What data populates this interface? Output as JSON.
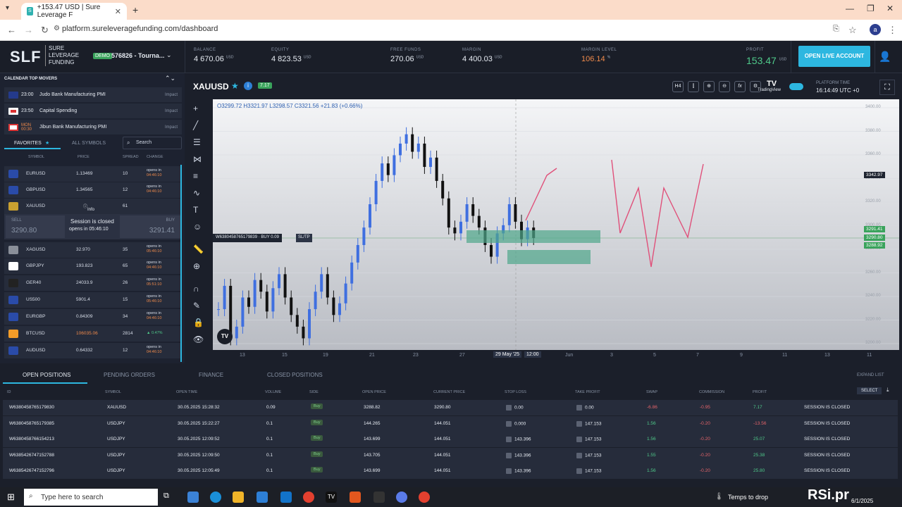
{
  "browser": {
    "tab_title": "+153.47 USD | Sure Leverage F",
    "url": "platform.sureleveragefunding.com/dashboard",
    "avatar": "a"
  },
  "header": {
    "logo": "SLF",
    "logo_sub": [
      "SURE",
      "LEVERAGE",
      "FUNDING"
    ],
    "demo": "DEMO",
    "account": "576826 - Tourna...",
    "balance_label": "BALANCE",
    "balance": "4 670.06",
    "currency": "USD",
    "equity_label": "EQUITY",
    "equity": "4 823.53",
    "free_funds_label": "FREE FUNDS",
    "free_funds": "270.06",
    "margin_label": "MARGIN",
    "margin": "4 400.03",
    "margin_level_label": "MARGIN LEVEL",
    "margin_level": "106.14",
    "margin_level_unit": "%",
    "profit_label": "PROFIT",
    "profit": "153.47",
    "open_live": "OPEN LIVE ACCOUNT"
  },
  "calendar": {
    "header": "CALENDAR  TOP MOVERS",
    "events": [
      {
        "time": "23:00",
        "name": "Judo Bank Manufacturing PMI",
        "impact": "Impact"
      },
      {
        "time": "23:50",
        "name": "Capital Spending",
        "impact": "Impact"
      },
      {
        "time": "MON 00:30",
        "name": "Jibun Bank Manufacturing PMI",
        "impact": "Impact"
      }
    ]
  },
  "symbols": {
    "tab_favorites": "FAVORITES",
    "tab_all": "ALL SYMBOLS",
    "search_placeholder": "Search",
    "col_symbol": "SYMBOL",
    "col_price": "PRICE",
    "col_spread": "SPREAD",
    "col_change": "CHANGE",
    "rows": [
      {
        "sym": "EURUSD",
        "price": "1.13469",
        "spread": "10",
        "open": "opens in",
        "t": "04:46:10"
      },
      {
        "sym": "GBPUSD",
        "price": "1.34565",
        "spread": "12",
        "open": "opens in",
        "t": "04:46:10"
      },
      {
        "sym": "XAUUSD",
        "price": "",
        "spread": "61",
        "open": "",
        "t": ""
      },
      {
        "sym": "XAGUSD",
        "price": "32.970",
        "spread": "35",
        "open": "opens in",
        "t": "05:46:10"
      },
      {
        "sym": "GBPJPY",
        "price": "193.823",
        "spread": "65",
        "open": "opens in",
        "t": "04:46:10"
      },
      {
        "sym": "GER40",
        "price": "24033.9",
        "spread": "26",
        "open": "opens in",
        "t": "05:51:10"
      },
      {
        "sym": "US500",
        "price": "5901.4",
        "spread": "15",
        "open": "opens in",
        "t": "05:46:10"
      },
      {
        "sym": "EURGBP",
        "price": "0.84309",
        "spread": "34",
        "open": "opens in",
        "t": "04:46:10"
      },
      {
        "sym": "BTCUSD",
        "price": "106035.06",
        "spread": "2814",
        "open": "▲ 0.47%",
        "t": ""
      },
      {
        "sym": "AUDUSD",
        "price": "0.64332",
        "spread": "12",
        "open": "opens in",
        "t": "04:46:10"
      }
    ],
    "xau_info": "Info",
    "sell_label": "SELL",
    "sell_price": "3290.80",
    "buy_label": "BUY",
    "buy_price": "3291.41",
    "session_closed": "Session is closed",
    "opens_in": "opens in 05:46:10"
  },
  "chart": {
    "symbol": "XAUUSD",
    "badge": "7.17",
    "timeframe": "H4",
    "ohlc": "O3299.72 H3321.97 L3298.57 C3321.56 +21.83 (+0.66%)",
    "tradingview": "TradingView",
    "platform_time_label": "PLATFORM TIME",
    "platform_time": "16:14:49 UTC +0",
    "position_label": "W638045876517983​9 · BUY 0.09",
    "sltp": "SL/TP",
    "price_labels": [
      "3342.97",
      "3291.41",
      "3290.80",
      "3288.92"
    ],
    "y_ticks": [
      "3400.00",
      "3380.00",
      "3360.00",
      "3340.00",
      "3320.00",
      "3300.00",
      "3280.00",
      "3260.00",
      "3240.00",
      "3220.00",
      "3200.00"
    ],
    "x_ticks": [
      "13",
      "15",
      "19",
      "21",
      "23",
      "27",
      "29 May '25",
      "12:00",
      "Jun",
      "3",
      "5",
      "7",
      "9",
      "11",
      "13",
      "11"
    ]
  },
  "chart_data": {
    "type": "candlestick",
    "title": "XAUUSD",
    "ylim": [
      3195,
      3410
    ],
    "closes": [
      3230,
      3250,
      3205,
      3215,
      3240,
      3232,
      3255,
      3245,
      3228,
      3248,
      3260,
      3240,
      3225,
      3215,
      3205,
      3230,
      3245,
      3260,
      3240,
      3225,
      3235,
      3252,
      3270,
      3285,
      3300,
      3320,
      3340,
      3355,
      3345,
      3362,
      3372,
      3380,
      3365,
      3372,
      3352,
      3360,
      3340,
      3325,
      3300,
      3295,
      3305,
      3320,
      3310,
      3300,
      3285,
      3275,
      3295,
      3302,
      3320,
      3305,
      3290,
      3300,
      3291
    ]
  },
  "bottom": {
    "tabs": [
      "OPEN POSITIONS",
      "PENDING ORDERS",
      "FINANCE",
      "CLOSED POSITIONS"
    ],
    "expand": "EXPAND LIST",
    "select": "SELECT",
    "headers": [
      "ID",
      "SYMBOL",
      "OPEN TIME",
      "VOLUME",
      "SIDE",
      "OPEN PRICE",
      "CURRENT PRICE",
      "STOP LOSS",
      "TAKE PROFIT",
      "SWAP",
      "COMMISSION",
      "PROFIT"
    ],
    "rows": [
      {
        "id": "W638045876517983​0",
        "sym": "XAUUSD",
        "time": "30.05.2025 15:28:32",
        "vol": "0.09",
        "side": "Buy",
        "open": "3288.82",
        "cur": "3290.80",
        "sl": "0.00",
        "tp": "0.00",
        "swap": "-6.86",
        "comm": "-0.95",
        "profit": "7.17",
        "status": "SESSION IS CLOSED"
      },
      {
        "id": "W638045876517938​5",
        "sym": "USDJPY",
        "time": "30.05.2025 15:22:27",
        "vol": "0.1",
        "side": "Buy",
        "open": "144.265",
        "cur": "144.051",
        "sl": "0.000",
        "tp": "147.153",
        "swap": "1.56",
        "comm": "-0.20",
        "profit": "-13.56",
        "status": "SESSION IS CLOSED"
      },
      {
        "id": "W638045876615421​3",
        "sym": "USDJPY",
        "time": "30.05.2025 12:09:52",
        "vol": "0.1",
        "side": "Buy",
        "open": "143.699",
        "cur": "144.051",
        "sl": "143.396",
        "tp": "147.153",
        "swap": "1.56",
        "comm": "-0.20",
        "profit": "25.07",
        "status": "SESSION IS CLOSED"
      },
      {
        "id": "W638542674715278​8",
        "sym": "USDJPY",
        "time": "30.05.2025 12:09:50",
        "vol": "0.1",
        "side": "Buy",
        "open": "143.705",
        "cur": "144.051",
        "sl": "143.396",
        "tp": "147.153",
        "swap": "1.55",
        "comm": "-0.20",
        "profit": "25.38",
        "status": "SESSION IS CLOSED"
      },
      {
        "id": "W638542674715279​6",
        "sym": "USDJPY",
        "time": "30.05.2025 12:05:49",
        "vol": "0.1",
        "side": "Buy",
        "open": "143.699",
        "cur": "144.051",
        "sl": "143.396",
        "tp": "147.153",
        "swap": "1.56",
        "comm": "-0.20",
        "profit": "25.80",
        "status": "SESSION IS CLOSED"
      }
    ]
  },
  "taskbar": {
    "search": "Type here to search",
    "weather": "Temps to drop",
    "date": "6/1/2025",
    "watermark": "RSi.pr"
  }
}
